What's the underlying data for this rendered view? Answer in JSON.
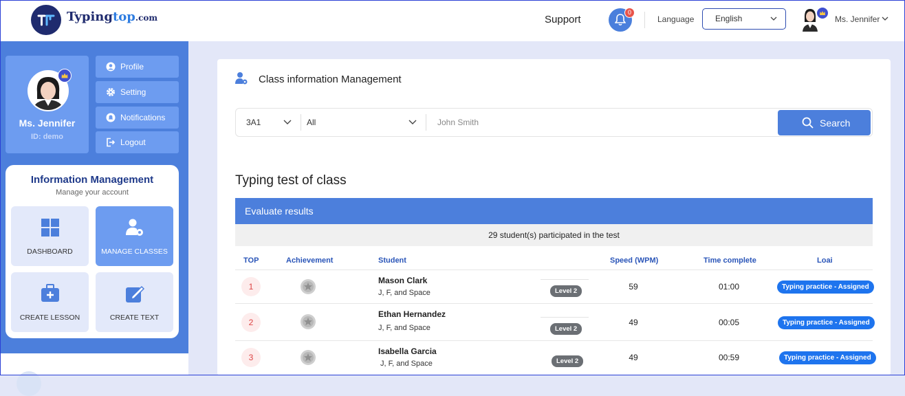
{
  "brand": {
    "name_part1": "Typing",
    "name_part2": "top",
    "name_suffix": ".com"
  },
  "header": {
    "support_label": "Support",
    "notification_count": "0",
    "language_label": "Language",
    "language_value": "English",
    "user_name": "Ms. Jennifer"
  },
  "profile": {
    "name": "Ms. Jennifer",
    "id_text": "ID: demo"
  },
  "account_menu": [
    {
      "label": "Profile",
      "icon": "user-circle-icon"
    },
    {
      "label": "Setting",
      "icon": "gear-icon"
    },
    {
      "label": "Notifications",
      "icon": "notification-icon"
    },
    {
      "label": "Logout",
      "icon": "logout-icon"
    }
  ],
  "info_management": {
    "title": "Information Management",
    "subtitle": "Manage your account",
    "tiles": [
      {
        "label": "DASHBOARD",
        "icon": "grid-icon",
        "active": false
      },
      {
        "label": "MANAGE CLASSES",
        "icon": "user-gear-icon",
        "active": true
      },
      {
        "label": "CREATE LESSON",
        "icon": "briefcase-plus-icon",
        "active": false
      },
      {
        "label": "CREATE TEXT",
        "icon": "edit-icon",
        "active": false
      }
    ]
  },
  "main": {
    "title": "Class information Management",
    "filters": {
      "class_value": "3A1",
      "scope_value": "All",
      "search_placeholder": "John Smith",
      "search_button": "Search"
    },
    "section_title": "Typing test of class",
    "evaluate_label": "Evaluate results",
    "participants_text": "29 student(s) participated in the test",
    "table": {
      "headers": {
        "top": "TOP",
        "achievement": "Achievement",
        "student": "Student",
        "speed": "Speed (WPM)",
        "time": "Time complete",
        "type": "Loai"
      },
      "rows": [
        {
          "rank": "1",
          "name": "Mason Clark",
          "keys": "J, F, and Space",
          "level": "Level 2",
          "speed": "59",
          "time": "01:00",
          "type": "Typing practice - Assigned"
        },
        {
          "rank": "2",
          "name": "Ethan Hernandez",
          "keys": "J, F, and Space",
          "level": "Level 2",
          "speed": "49",
          "time": "00:05",
          "type": "Typing practice - Assigned"
        },
        {
          "rank": "3",
          "name": "Isabella Garcia",
          "keys": "J, F, and Space",
          "level": "Level 2",
          "speed": "49",
          "time": "00:59",
          "type": "Typing practice - Assigned"
        }
      ]
    }
  },
  "colors": {
    "primary": "#4c7fdc",
    "light_primary": "#6d9cf0",
    "navy": "#1f2b6e",
    "badge_blue": "#1e74ee",
    "rank_red": "#dd4444"
  }
}
